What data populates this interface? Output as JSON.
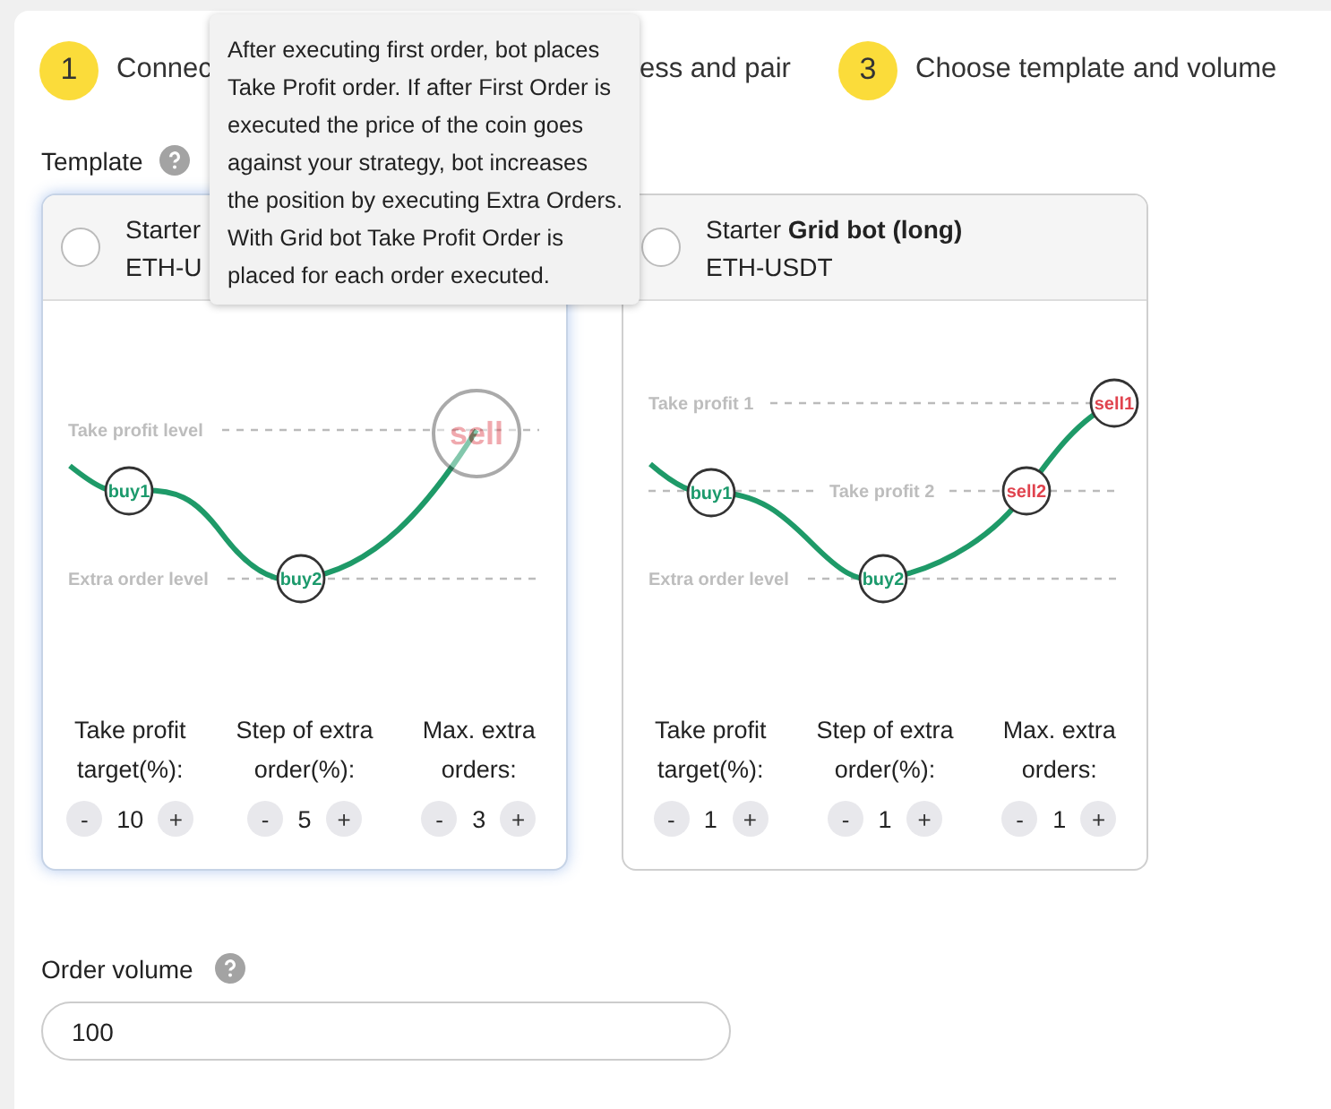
{
  "steps": [
    {
      "number": "1",
      "label": "Connec"
    },
    {
      "label": "ess and pair"
    },
    {
      "number": "3",
      "label": "Choose template and volume"
    }
  ],
  "template": {
    "label": "Template",
    "cards": [
      {
        "kind": "simple",
        "title": "Starter",
        "pair": "ETH-U",
        "checked": false,
        "selected": true,
        "chart": {
          "levels": [
            "Take profit level",
            "Extra order level"
          ],
          "markers": [
            {
              "label": "buy1",
              "kind": "buy",
              "faded": false
            },
            {
              "label": "buy2",
              "kind": "buy",
              "faded": false
            },
            {
              "label": "sell",
              "kind": "sell",
              "faded": true
            }
          ]
        },
        "params": [
          {
            "label": "Take profit target(%):",
            "value": "10",
            "minus": "-",
            "plus": "+"
          },
          {
            "label": "Step of extra order(%):",
            "value": "5",
            "minus": "-",
            "plus": "+"
          },
          {
            "label": "Max. extra orders:",
            "value": "3",
            "minus": "-",
            "plus": "+"
          }
        ]
      },
      {
        "kind": "grid",
        "title": "Starter **Grid bot (long)**",
        "pair": "ETH-USDT",
        "checked": false,
        "selected": false,
        "chart": {
          "levels": [
            "Take profit 1",
            "Take profit 2",
            "Extra order level"
          ],
          "markers": [
            {
              "label": "buy1",
              "kind": "buy",
              "faded": false
            },
            {
              "label": "buy2",
              "kind": "buy",
              "faded": false
            },
            {
              "label": "sell2",
              "kind": "sell",
              "faded": false
            },
            {
              "label": "sell1",
              "kind": "sell",
              "faded": false
            }
          ]
        },
        "params": [
          {
            "label": "Take profit target(%):",
            "value": "1",
            "minus": "-",
            "plus": "+"
          },
          {
            "label": "Step of extra order(%):",
            "value": "1",
            "minus": "-",
            "plus": "+"
          },
          {
            "label": "Max. extra orders:",
            "value": "1",
            "minus": "-",
            "plus": "+"
          }
        ]
      }
    ]
  },
  "tooltip": "After executing first order, bot places Take Profit order. If after First Order is executed the price of the coin goes against your strategy, bot increases the position by executing Extra Orders. With Grid bot Take Profit Order is placed for each order executed.",
  "order_volume": {
    "label": "Order volume",
    "value": "100"
  }
}
